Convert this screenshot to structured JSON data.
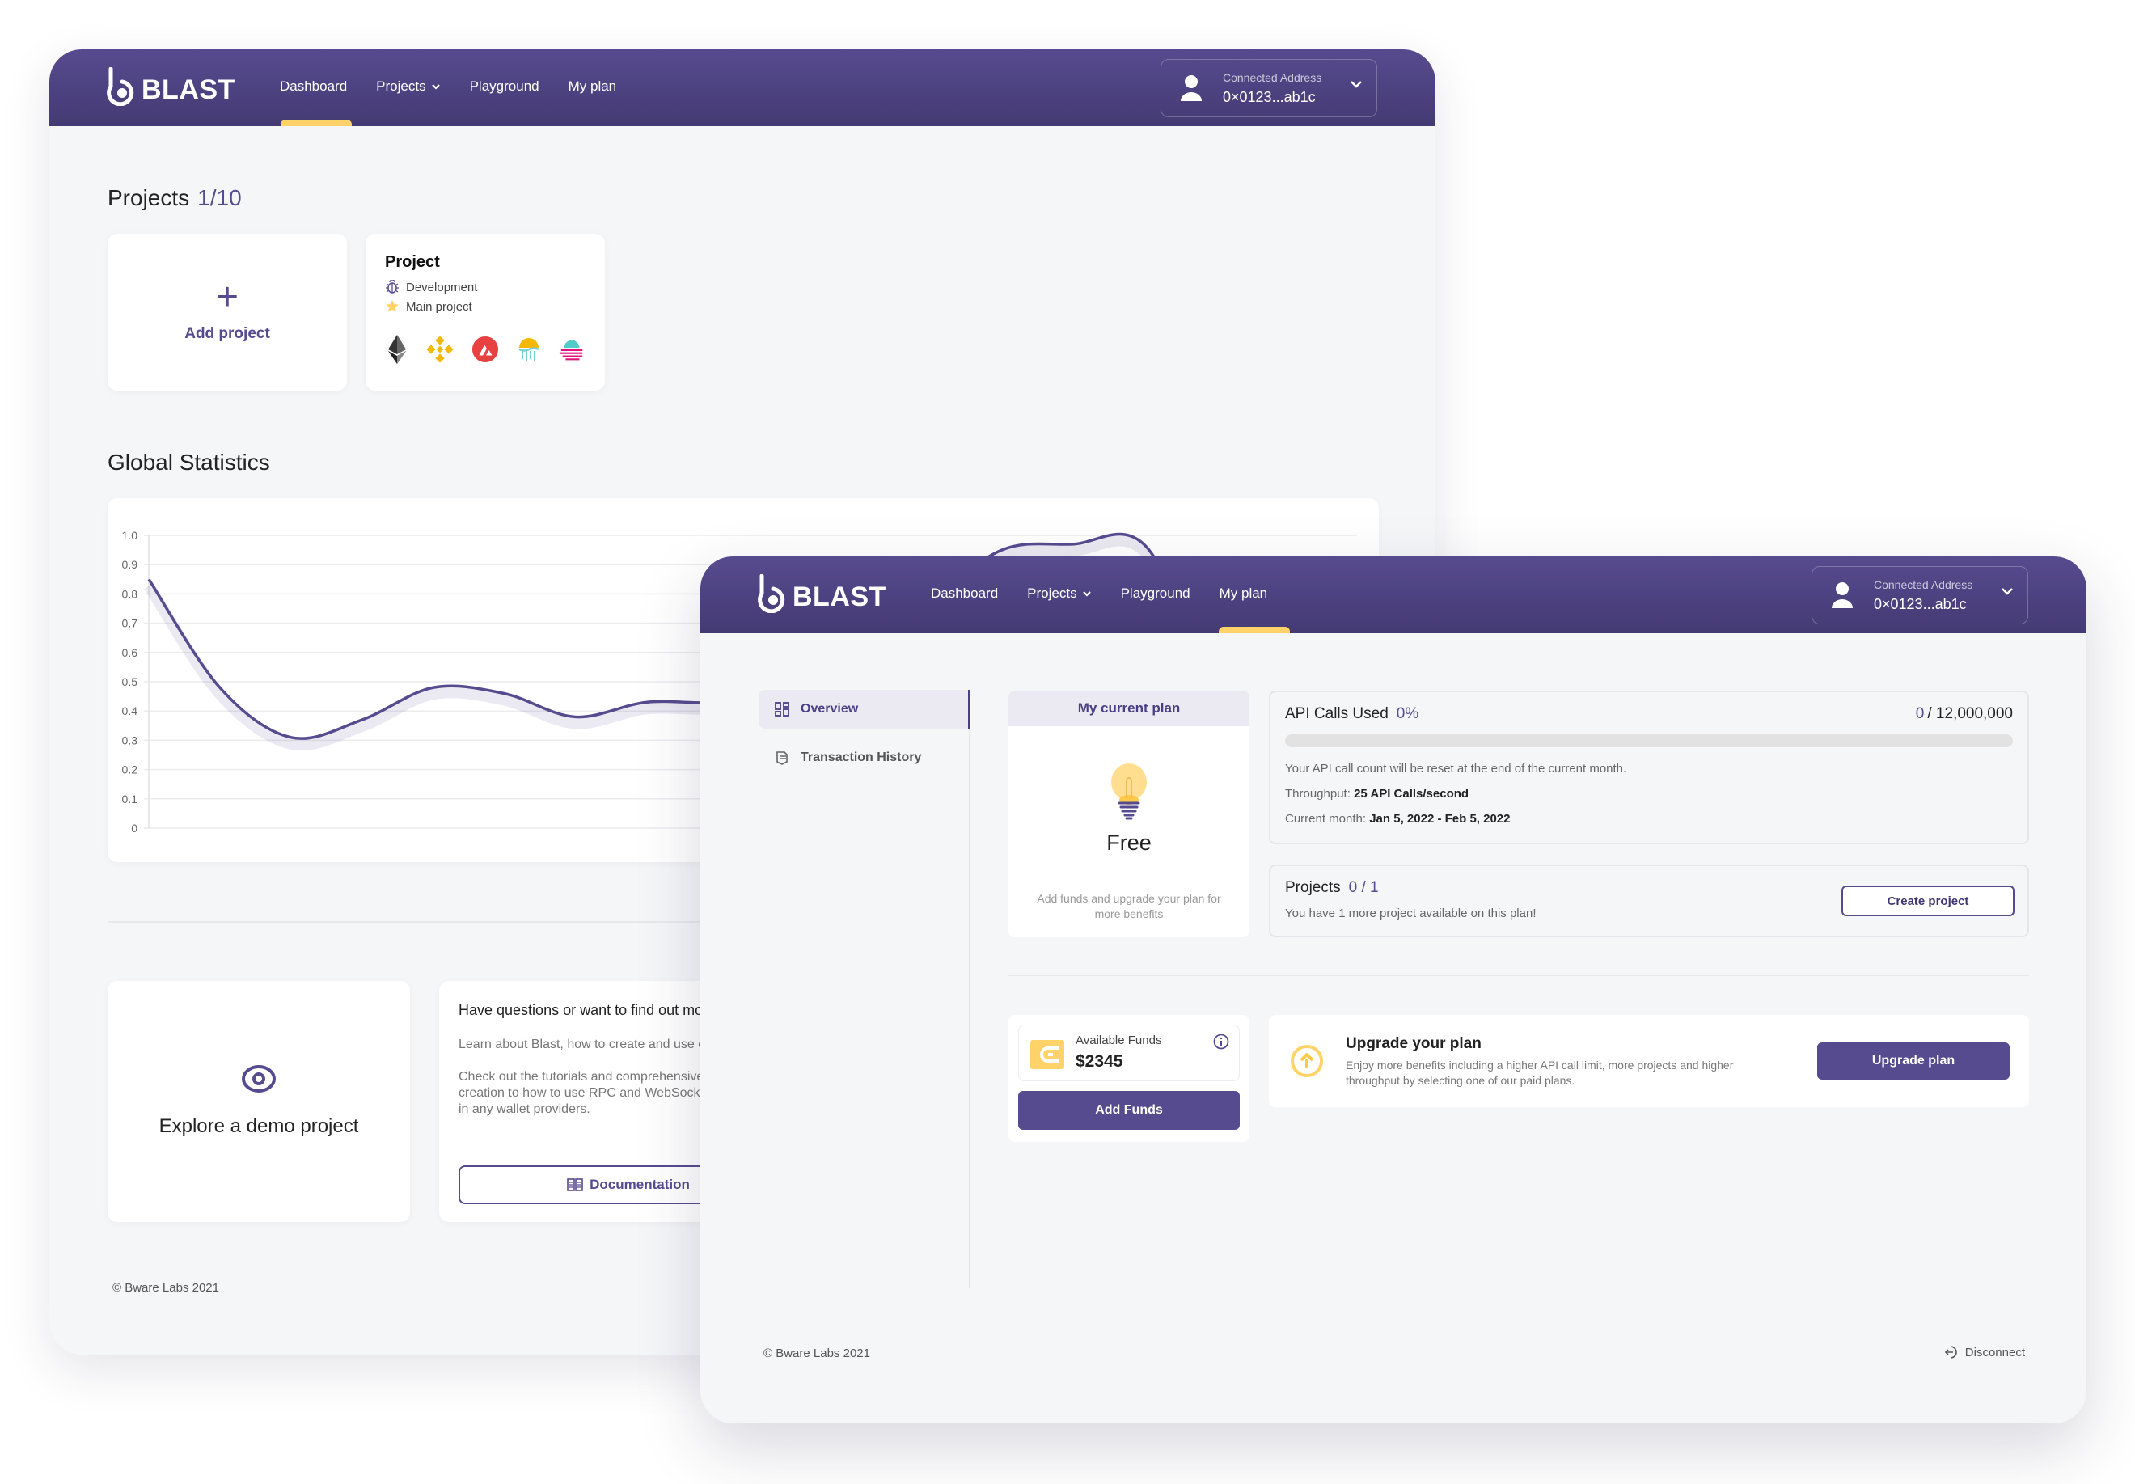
{
  "brand": {
    "name": "BLAST",
    "accent": "#574b8f",
    "highlight": "#ffd36a"
  },
  "nav": {
    "items": [
      {
        "label": "Dashboard"
      },
      {
        "label": "Projects",
        "has_dropdown": true
      },
      {
        "label": "Playground"
      },
      {
        "label": "My plan"
      }
    ]
  },
  "account": {
    "label": "Connected Address",
    "address": "0×0123...ab1c"
  },
  "dashboard": {
    "active_nav": "Dashboard",
    "projects_title": "Projects",
    "projects_count": "1/10",
    "add_project_label": "Add project",
    "project_card": {
      "name": "Project",
      "environment": "Development",
      "tag": "Main project",
      "chains": [
        "ethereum",
        "binance-smart-chain",
        "avalanche",
        "fantom-jellyfish",
        "moonriver"
      ]
    },
    "stats_title": "Global Statistics",
    "demo_label": "Explore a demo project",
    "docs": {
      "title": "Have questions or want to find out more?",
      "p1": "Learn about Blast, how to create and use endpoints",
      "p2_lines": [
        "Check out the tutorials and comprehensive guides, from project",
        "creation to how to use RPC and WebSocket endpoints",
        "in any wallet providers."
      ],
      "button": "Documentation"
    },
    "footer": "© Bware Labs 2021"
  },
  "chart_data": {
    "type": "line",
    "title": "Global Statistics",
    "xlabel": "",
    "ylabel": "",
    "ylim": [
      0,
      1.0
    ],
    "yticks": [
      "0",
      "0.1",
      "0.2",
      "0.3",
      "0.4",
      "0.5",
      "0.6",
      "0.7",
      "0.8",
      "0.9",
      "1.0"
    ],
    "grid": true,
    "series": [
      {
        "name": "usage",
        "color": "#574b8f",
        "x": [
          0,
          1,
          2,
          3,
          4,
          5,
          6,
          7,
          8,
          9,
          10,
          11,
          12,
          13,
          14,
          15,
          16,
          17
        ],
        "values": [
          0.85,
          0.48,
          0.31,
          0.37,
          0.48,
          0.46,
          0.38,
          0.43,
          0.43,
          0.47,
          0.56,
          0.77,
          0.95,
          0.97,
          0.97,
          0.52,
          0.4,
          0.33
        ]
      }
    ]
  },
  "plan": {
    "active_nav": "My plan",
    "sidebar": [
      {
        "label": "Overview",
        "icon": "grid-icon",
        "active": true
      },
      {
        "label": "Transaction History",
        "icon": "receipt-icon",
        "active": false
      }
    ],
    "current_plan_title": "My current plan",
    "plan_name": "Free",
    "plan_hint": "Add funds and upgrade your plan for more benefits",
    "api": {
      "title": "API Calls Used",
      "percent": "0%",
      "used": "0",
      "limit": "/ 12,000,000",
      "progress_fraction": 0,
      "reset_note": "Your API call count will be reset at the end of the current month.",
      "throughput_label": "Throughput:",
      "throughput_value": "25 API Calls/second",
      "month_label": "Current month:",
      "month_value": "Jan 5, 2022 - Feb 5, 2022"
    },
    "projects": {
      "title": "Projects",
      "count": "0 / 1",
      "note": "You have 1 more project available on this plan!",
      "button": "Create project"
    },
    "funds": {
      "label": "Available Funds",
      "value": "$2345",
      "button": "Add Funds"
    },
    "upgrade": {
      "title": "Upgrade your plan",
      "description": "Enjoy more benefits including a higher API call limit, more projects and higher throughput by selecting one of our paid plans.",
      "button": "Upgrade plan"
    },
    "footer": "© Bware Labs 2021",
    "disconnect": "Disconnect"
  }
}
